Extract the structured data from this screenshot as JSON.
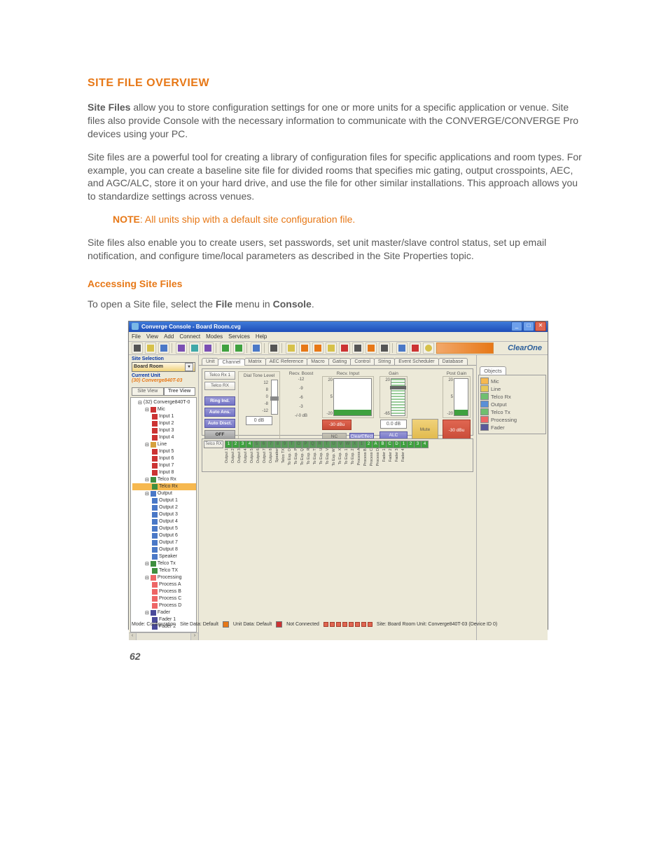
{
  "page_number": "62",
  "heading": "SITE FILE OVERVIEW",
  "para1_a": "Site Files",
  "para1_b": " allow you to store configuration settings for one or more units for a specific application or venue. Site files also provide Console with the necessary information to communicate with the CONVERGE/CONVERGE Pro devices using your PC.",
  "para2": "Site files are a powerful tool for creating a library of configuration files for specific applications and room types. For example, you can create a baseline site file for divided rooms that specifies mic gating, output crosspoints, AEC, and AGC/ALC,  store it on your hard drive, and use the file for other similar installations. This approach allows you to standardize settings across venues.",
  "note_label": "NOTE",
  "note_text": ": All units ship with a default site configuration file.",
  "para3": "Site files also enable you to create users, set passwords, set unit master/slave control status, set up email notification, and configure time/local parameters as described in the Site Properties topic.",
  "subheading": "Accessing Site Files",
  "para4_a": "To open a Site file, select the ",
  "para4_b": "File",
  "para4_c": " menu in ",
  "para4_d": "Console",
  "para4_e": ".",
  "win": {
    "title": "Converge Console - Board Room.cvg",
    "menus": [
      "File",
      "View",
      "Add",
      "Connect",
      "Modes",
      "Services",
      "Help"
    ],
    "brand": "ClearOne",
    "left": {
      "site_selection_label": "Site Selection",
      "site_selection_value": "Board Room",
      "current_unit_label": "Current Unit",
      "current_unit_value": "(30) Converge840T-03",
      "view_tabs": [
        "Site View",
        "Tree View"
      ],
      "tree_root": "(32) Converge840T-0",
      "tree": {
        "mic": "Mic",
        "mic_items": [
          "Input 1",
          "Input 2",
          "Input 3",
          "Input 4"
        ],
        "line": "Line",
        "line_items": [
          "Input 5",
          "Input 6",
          "Input 7",
          "Input 8"
        ],
        "telco_rx": "Telco Rx",
        "telco_rx_item": "Telco Rx",
        "output": "Output",
        "output_items": [
          "Output 1",
          "Output 2",
          "Output 3",
          "Output 4",
          "Output 5",
          "Output 6",
          "Output 7",
          "Output 8",
          "Speaker"
        ],
        "telco_tx": "Telco Tx",
        "telco_tx_item": "Telco TX",
        "processing": "Processing",
        "processing_items": [
          "Process A",
          "Process B",
          "Process C",
          "Process D"
        ],
        "fader": "Fader",
        "fader_items": [
          "Fader 1",
          "Fader 2"
        ]
      }
    },
    "center": {
      "tabs": [
        "Unit",
        "Channel",
        "Matrix",
        "AEC Reference",
        "Macro",
        "Gating",
        "Control",
        "String",
        "Event Scheduler",
        "Database"
      ],
      "row_label1": "Telco Rx 1",
      "row_label2": "Telco RX",
      "buttons": {
        "ring": "Ring Ind.",
        "auto_ans": "Auto Ans.",
        "auto_disc": "Auto Disct.",
        "off": "OFF"
      },
      "dtl_title": "Dial Tone Level",
      "dtl_marks": [
        "12",
        "8",
        "0",
        "-8",
        "-12"
      ],
      "dtl_value": "0 dB",
      "recv_boost_title": "Recv. Boost",
      "recv_boost_marks": [
        "-12",
        "-9",
        "-6",
        "-3",
        "-/-0 dB"
      ],
      "recv_input_title": "Recv. Input",
      "meter_marks": [
        "20",
        "5",
        "-20"
      ],
      "recv_input_readout": "-30 dBu",
      "gain_title": "Gain",
      "gain_marks": [
        "20",
        "-65"
      ],
      "gain_value": "0.0 dB",
      "post_gain_title": "Post Gain",
      "post_gain_readout": "-30 dBu",
      "sbtns": {
        "nc": "NC",
        "ce": "ClearEffect",
        "alc": "ALC",
        "mute": "Mute"
      },
      "matrix_row": "Telco RX",
      "matrix_headnums": [
        "1",
        "2",
        "3",
        "4",
        "5",
        "6",
        "7",
        "8",
        "9",
        "T",
        "O",
        "P",
        "Q",
        "R",
        "T",
        "U",
        "V",
        "W",
        "X",
        "1",
        "2",
        "A",
        "B",
        "C",
        "D",
        "1",
        "2",
        "3",
        "4"
      ],
      "matrix_cols": [
        "Output 1",
        "Output 2",
        "Output 3",
        "Output 4",
        "Output 5",
        "Output 6",
        "Output 7",
        "Output 8",
        "Speaker",
        "Telco TX",
        "To Exp. O",
        "To Exp. P",
        "To Exp. Q",
        "To Exp. R",
        "To Exp. T",
        "To Exp. U",
        "To Exp. V",
        "To Exp. W",
        "To Exp. X",
        "To Exp. 1",
        "To Exp. 2",
        "Process A",
        "Process B",
        "Process C",
        "Process D",
        "Fader 1",
        "Fader 2",
        "Fader 3",
        "Fader 4"
      ]
    },
    "right": {
      "tab": "Objects",
      "items": [
        "Mic",
        "Line",
        "Telco Rx",
        "Output",
        "Telco Tx",
        "Processing",
        "Fader"
      ]
    },
    "status": {
      "mode": "Mode: Configuration",
      "sitedata": "Site Data: Default",
      "unitdata": "Unit Data: Default",
      "conn": "Not Connected",
      "trail": "Site: Board Room   Unit: Converge840T-03 (Device ID 0)"
    }
  }
}
